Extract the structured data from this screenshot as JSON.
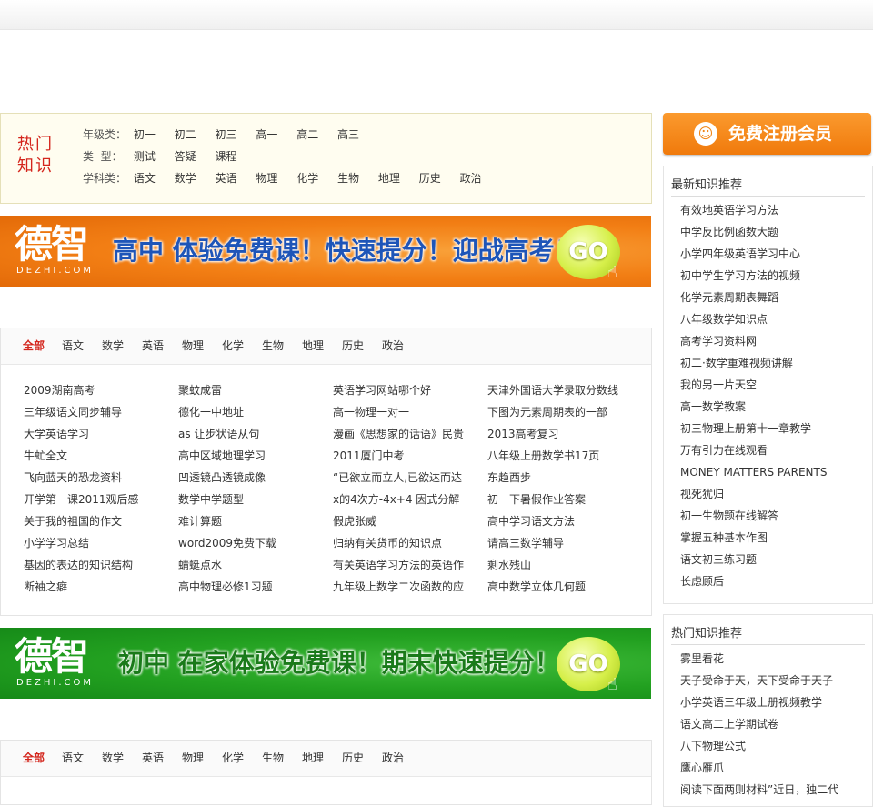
{
  "hot": {
    "title": "热门知识",
    "grade_label": "年级类：",
    "grades": [
      "初一",
      "初二",
      "初三",
      "高一",
      "高二",
      "高三"
    ],
    "type_label": "类  型：",
    "types": [
      "测试",
      "答疑",
      "课程"
    ],
    "subject_label": "学科类：",
    "subjects": [
      "语文",
      "数学",
      "英语",
      "物理",
      "化学",
      "生物",
      "地理",
      "历史",
      "政治"
    ]
  },
  "banner1": {
    "logo": "德智",
    "logo_sub": "DEZHI.COM",
    "slogan": "高中 体验免费课！快速提分！迎战高考！",
    "go": "GO"
  },
  "banner2": {
    "logo": "德智",
    "logo_sub": "DEZHI.COM",
    "slogan": "初中 在家体验免费课！期末快速提分！",
    "go": "GO"
  },
  "tabs": [
    "全部",
    "语文",
    "数学",
    "英语",
    "物理",
    "化学",
    "生物",
    "地理",
    "历史",
    "政治"
  ],
  "links": [
    [
      "2009湖南高考",
      "三年级语文同步辅导",
      "大学英语学习",
      "牛虻全文",
      "飞向蓝天的恐龙资料",
      "开学第一课2011观后感",
      "关于我的祖国的作文",
      "小学学习总结",
      "基因的表达的知识结构",
      "断袖之癖"
    ],
    [
      "聚蚊成雷",
      "德化一中地址",
      "as 让步状语从句",
      "高中区域地理学习",
      "凹透镜凸透镜成像",
      "数学中学题型",
      "难计算题",
      "word2009免费下载",
      "蜻蜓点水",
      "高中物理必修1习题"
    ],
    [
      "英语学习网站哪个好",
      "高一物理一对一",
      "漫画《思想家的话语》民贵",
      "2011厦门中考",
      "“已欲立而立人,已欲达而达",
      "x的4次方-4x+4 因式分解",
      "假虎张威",
      "归纳有关货币的知识点",
      "有关英语学习方法的英语作",
      "九年级上数学二次函数的应"
    ],
    [
      "天津外国语大学录取分数线",
      "下图为元素周期表的一部",
      "2013高考复习",
      "八年级上册数学书17页",
      "东趋西步",
      "初一下暑假作业答案",
      "高中学习语文方法",
      "请高三数学辅导",
      "剩水残山",
      "高中数学立体几何题"
    ]
  ],
  "sidebar": {
    "register": "免费注册会员",
    "new_title": "最新知识推荐",
    "new_items": [
      "有效地英语学习方法",
      "中学反比例函数大题",
      "小学四年级英语学习中心",
      "初中学生学习方法的视频",
      "化学元素周期表舞蹈",
      "八年级数学知识点",
      "高考学习资料网",
      "初二·数学重难视频讲解",
      "我的另一片天空",
      "高一数学教案",
      "初三物理上册第十一章教学",
      "万有引力在线观看",
      "MONEY MATTERS PARENTS",
      "视死犹归",
      "初一生物题在线解答",
      "掌握五种基本作图",
      "语文初三练习题",
      "长虑顾后"
    ],
    "hot_title": "热门知识推荐",
    "hot_items": [
      "雾里看花",
      "天子受命于天，天下受命于天子",
      "小学英语三年级上册视频教学",
      "语文高二上学期试卷",
      "八下物理公式",
      "鹰心雁爪",
      "阅读下面两则材料”近日，独二代"
    ]
  },
  "colors": {
    "accent_red": "#d4251c",
    "orange": "#f27e14",
    "green": "#22a020"
  }
}
